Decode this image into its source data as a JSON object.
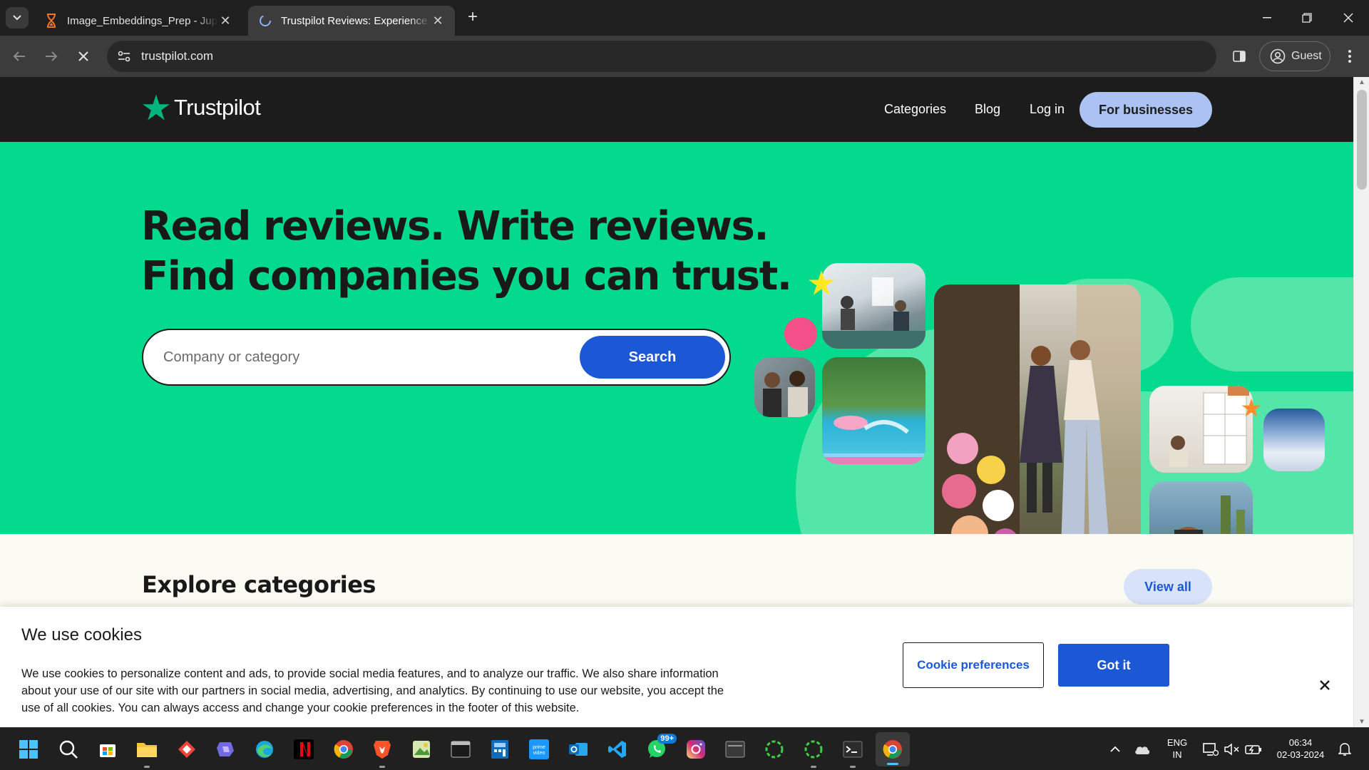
{
  "browser": {
    "tabs": [
      {
        "title": "Image_Embeddings_Prep - Jupyter",
        "active": false
      },
      {
        "title": "Trustpilot Reviews: Experience the power of customer reviews",
        "active": true
      }
    ],
    "url": "trustpilot.com",
    "profile_label": "Guest"
  },
  "site": {
    "logo_text": "Trustpilot",
    "nav": {
      "categories": "Categories",
      "blog": "Blog",
      "login": "Log in",
      "for_businesses": "For businesses"
    },
    "hero": {
      "headline_line1": "Read reviews. Write reviews.",
      "headline_line2": "Find companies you can trust.",
      "search_placeholder": "Company or category",
      "search_button": "Search"
    },
    "explore": {
      "title": "Explore categories",
      "view_all": "View all"
    },
    "cookie": {
      "title": "We use cookies",
      "body": "We use cookies to personalize content and ads, to provide social media features, and to analyze our traffic. We also share information about your use of our site with our partners in social media, advertising, and analytics. By continuing to use our website, you accept the use of all cookies. You can always access and change your cookie preferences in the footer of this website.",
      "preferences_button": "Cookie preferences",
      "accept_button": "Got it"
    },
    "colors": {
      "brand_green": "#04da8d",
      "star_green": "#00b67a",
      "primary_blue": "#1c57d6",
      "header_dark": "#1c1c1c"
    }
  },
  "taskbar": {
    "apps": [
      "windows-start",
      "search",
      "microsoft-store",
      "file-explorer",
      "anydesk",
      "copilot",
      "edge",
      "netflix",
      "chrome",
      "brave",
      "photos",
      "terminal-window",
      "calculator",
      "prime-video",
      "outlook",
      "vscode",
      "whatsapp",
      "instagram",
      "app-window",
      "loader-app-1",
      "loader-app-2",
      "terminal",
      "chrome-active"
    ],
    "whatsapp_badge": "99+",
    "language_line1": "ENG",
    "language_line2": "IN",
    "time": "06:34",
    "date": "02-03-2024"
  }
}
